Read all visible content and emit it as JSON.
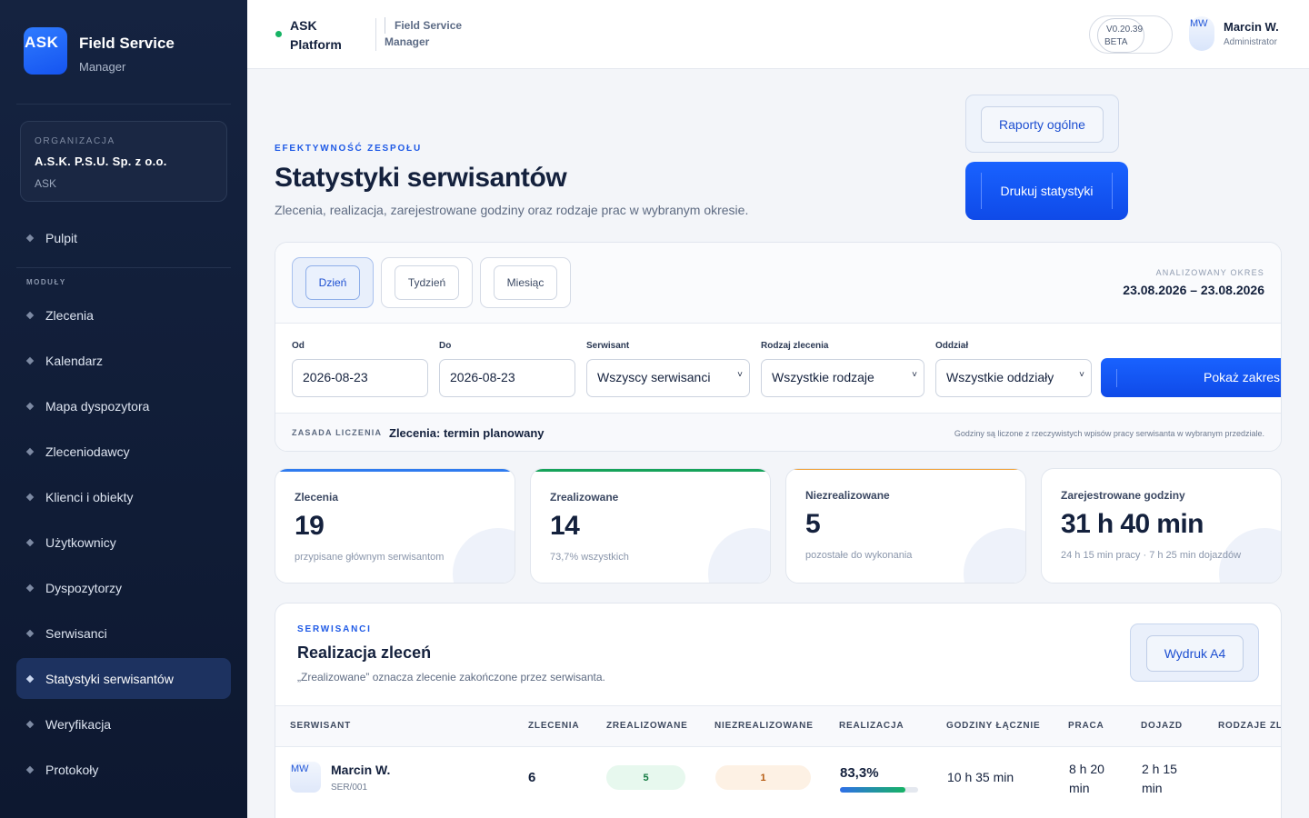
{
  "sidebar": {
    "logo": "ASK",
    "brand_title": "Field Service",
    "brand_sub": "Manager",
    "org_label": "ORGANIZACJA",
    "org_name": "A.S.K. P.S.U. Sp. z o.o.",
    "org_short": "ASK",
    "dashboard": "Pulpit",
    "modules_label": "MODUŁY",
    "items": [
      {
        "label": "Zlecenia"
      },
      {
        "label": "Kalendarz"
      },
      {
        "label": "Mapa dyspozytora"
      },
      {
        "label": "Zleceniodawcy"
      },
      {
        "label": "Klienci i obiekty"
      },
      {
        "label": "Użytkownicy"
      },
      {
        "label": "Dyspozytorzy"
      },
      {
        "label": "Serwisanci"
      },
      {
        "label": "Statystyki serwisantów",
        "active": true
      },
      {
        "label": "Weryfikacja"
      },
      {
        "label": "Protokoły"
      }
    ]
  },
  "header": {
    "platform_line1": "ASK",
    "platform_line2": "Platform",
    "module_line1": "Field Service",
    "module_line2": "Manager",
    "version": "V0.20.39",
    "version_tag": "BETA",
    "user_initials": "MW",
    "user_name": "Marcin W.",
    "user_role": "Administrator",
    "status_color": "#16b364"
  },
  "page": {
    "eyebrow": "EFEKTYWNOŚĆ ZESPOŁU",
    "title": "Statystyki serwisantów",
    "description": "Zlecenia, realizacja, zarejestrowane godziny oraz rodzaje prac w wybranym okresie.",
    "reports_button": "Raporty ogólne",
    "print_button": "Drukuj statystyki"
  },
  "filters": {
    "periods": [
      "Dzień",
      "Tydzień",
      "Miesiąc"
    ],
    "active_period": "Dzień",
    "analyzed_label": "ANALIZOWANY OKRES",
    "analyzed_value": "23.08.2026 – 23.08.2026",
    "from_label": "Od",
    "from_value": "2026-08-23",
    "to_label": "Do",
    "to_value": "2026-08-23",
    "technician_label": "Serwisant",
    "technician_value": "Wszyscy serwisanci",
    "order_type_label": "Rodzaj zlecenia",
    "order_type_value": "Wszystkie rodzaje",
    "branch_label": "Oddział",
    "branch_value": "Wszystkie oddziały",
    "submit": "Pokaż zakres",
    "rule_label": "ZASADA LICZENIA",
    "rule_value": "Zlecenia: termin planowany",
    "rule_note": "Godziny są liczone z rzeczywistych wpisów pracy serwisanta w wybranym przedziale."
  },
  "stats": [
    {
      "label": "Zlecenia",
      "value": "19",
      "note": "przypisane głównym serwisantom",
      "accent": "#2f7bef"
    },
    {
      "label": "Zrealizowane",
      "value": "14",
      "note": "73,7% wszystkich",
      "accent": "#16a35a"
    },
    {
      "label": "Niezrealizowane",
      "value": "5",
      "note": "pozostałe do wykonania",
      "accent": "#f0a23a"
    },
    {
      "label": "Zarejestrowane godziny",
      "value": "31 h 40 min",
      "note": "24 h 15 min pracy · 7 h 25 min dojazdów",
      "accent": ""
    }
  ],
  "table": {
    "eyebrow": "SERWISANCI",
    "title": "Realizacja zleceń",
    "description": "„Zrealizowane” oznacza zlecenie zakończone przez serwisanta.",
    "print_button": "Wydruk A4",
    "columns": [
      "SERWISANT",
      "ZLECENIA",
      "ZREALIZOWANE",
      "NIEZREALIZOWANE",
      "REALIZACJA",
      "GODZINY ŁĄCZNIE",
      "PRACA",
      "DOJAZD",
      "RODZAJE ZL"
    ],
    "rows": [
      {
        "initials": "MW",
        "name": "Marcin W.",
        "code": "SER/001",
        "orders": "6",
        "done": "5",
        "not_done": "1",
        "rate": "83,3%",
        "rate_value": 83.3,
        "hours_total": "10 h 35 min",
        "work_line1": "8 h 20",
        "work_line2": "min",
        "travel_line1": "2 h 15",
        "travel_line2": "min"
      }
    ]
  }
}
